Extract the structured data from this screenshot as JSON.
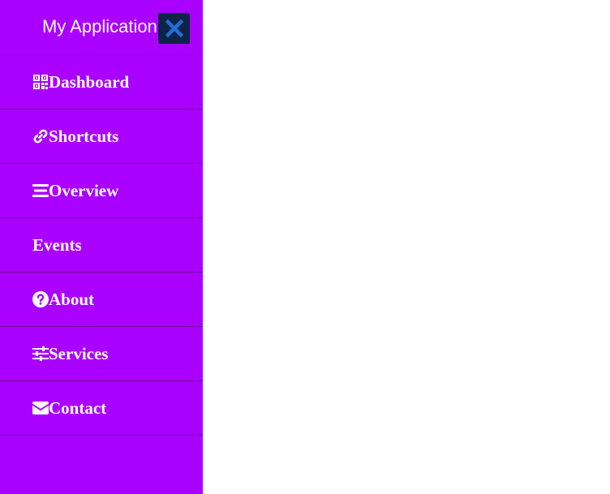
{
  "app": {
    "title": "My Application"
  },
  "colors": {
    "sidebar_background": "#aa00ff",
    "close_button_background": "#0d2448",
    "close_icon": "#1e6fd6",
    "divider": "#6a00a0",
    "text": "#ffffff",
    "page_background": "#ffffff"
  },
  "sidebar": {
    "close_icon": "close-icon",
    "items": [
      {
        "label": "Dashboard",
        "icon": "qrcode-icon"
      },
      {
        "label": "Shortcuts",
        "icon": "link-icon"
      },
      {
        "label": "Overview",
        "icon": "menu-icon"
      },
      {
        "label": "Events",
        "icon": ""
      },
      {
        "label": "About",
        "icon": "question-circle-icon"
      },
      {
        "label": "Services",
        "icon": "sliders-icon"
      },
      {
        "label": "Contact",
        "icon": "envelope-icon"
      }
    ]
  }
}
